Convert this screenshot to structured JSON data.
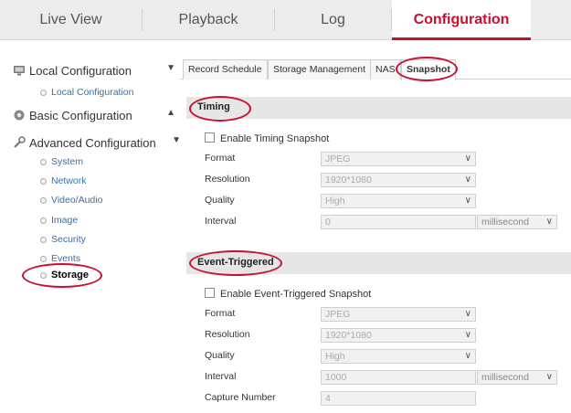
{
  "nav": {
    "tabs": [
      {
        "label": "Live View"
      },
      {
        "label": "Playback"
      },
      {
        "label": "Log"
      },
      {
        "label": "Configuration"
      }
    ],
    "active": "Configuration"
  },
  "sidebar": {
    "local": {
      "label": "Local Configuration",
      "items": [
        "Local Configuration"
      ]
    },
    "basic": {
      "label": "Basic Configuration"
    },
    "advanced": {
      "label": "Advanced Configuration",
      "items": [
        "System",
        "Network",
        "Video/Audio",
        "Image",
        "Security",
        "Events",
        "Storage"
      ]
    }
  },
  "content": {
    "tabs": [
      "Record Schedule",
      "Storage Management",
      "NAS",
      "Snapshot"
    ],
    "active_tab": "Snapshot",
    "timing": {
      "title": "Timing",
      "enable_label": "Enable Timing Snapshot",
      "fields": {
        "format": {
          "label": "Format",
          "value": "JPEG"
        },
        "resolution": {
          "label": "Resolution",
          "value": "1920*1080"
        },
        "quality": {
          "label": "Quality",
          "value": "High"
        },
        "interval": {
          "label": "Interval",
          "value": "0",
          "unit": "millisecond"
        }
      }
    },
    "event": {
      "title": "Event-Triggered",
      "enable_label": "Enable Event-Triggered Snapshot",
      "fields": {
        "format": {
          "label": "Format",
          "value": "JPEG"
        },
        "resolution": {
          "label": "Resolution",
          "value": "1920*1080"
        },
        "quality": {
          "label": "Quality",
          "value": "High"
        },
        "interval": {
          "label": "Interval",
          "value": "1000",
          "unit": "millisecond"
        },
        "capture_number": {
          "label": "Capture Number",
          "value": "4"
        }
      }
    }
  },
  "colors": {
    "accent": "#c8102e",
    "link": "#3a6ea8"
  }
}
